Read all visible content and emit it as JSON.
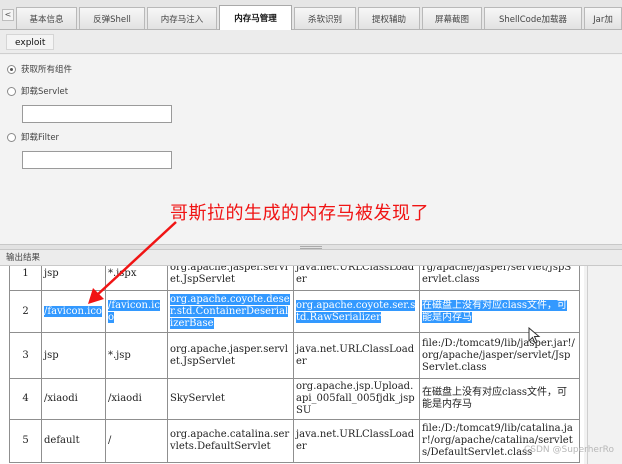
{
  "tabs": [
    {
      "label": "基本信息",
      "active": false
    },
    {
      "label": "反弹Shell",
      "active": false
    },
    {
      "label": "内存马注入",
      "active": false
    },
    {
      "label": "内存马管理",
      "active": true
    },
    {
      "label": "杀软识别",
      "active": false
    },
    {
      "label": "提权辅助",
      "active": false
    },
    {
      "label": "屏幕截图",
      "active": false
    },
    {
      "label": "ShellCode加载器",
      "active": false
    },
    {
      "label": "Jar加",
      "active": false
    }
  ],
  "tab_arrow": "<",
  "toolbar": {
    "exploit_label": "exploit"
  },
  "options": {
    "get_all_label": "获取所有组件",
    "uninstall_servlet_label": "卸载Servlet",
    "servlet_input_value": "",
    "uninstall_filter_label": "卸载Filter",
    "filter_input_value": ""
  },
  "annotation": "哥斯拉的生成的内存马被发现了",
  "output": {
    "header": "输出结果"
  },
  "results": {
    "rows": [
      {
        "cells": [
          "1",
          "jsp",
          "*.jspx",
          "org.apache.jasper.servlet.JspServlet",
          "java.net.URLClassLoader",
          "rg/apache/jasper/servlet/JspServlet.class"
        ]
      },
      {
        "cells": [
          "2",
          "/favicon.ico",
          "/favicon.ico",
          "org.apache.coyote.deser.std.ContainerDeserializerBase",
          "org.apache.coyote.ser.std.RawSerializer",
          "在磁盘上没有对应class文件，可能是内存马"
        ]
      },
      {
        "cells": [
          "3",
          "jsp",
          "*.jsp",
          "org.apache.jasper.servlet.JspServlet",
          "java.net.URLClassLoader",
          "file:/D:/tomcat9/lib/jasper.jar!/org/apache/jasper/servlet/JspServlet.class"
        ]
      },
      {
        "cells": [
          "4",
          "/xiaodi",
          "/xiaodi",
          "SkyServlet",
          "org.apache.jsp.Upload.api_005fall_005fjdk_jspSU",
          "在磁盘上没有对应class文件，可能是内存马"
        ]
      },
      {
        "cells": [
          "5",
          "default",
          "/",
          "org.apache.catalina.servlets.DefaultServlet",
          "java.net.URLClassLoader",
          "file:/D:/tomcat9/lib/catalina.jar!/org/apache/catalina/servlets/DefaultServlet.class"
        ]
      }
    ]
  },
  "watermark": "CSDN @SuperherRo",
  "colors": {
    "highlight": "#3399ff",
    "annotation": "#f01414"
  }
}
